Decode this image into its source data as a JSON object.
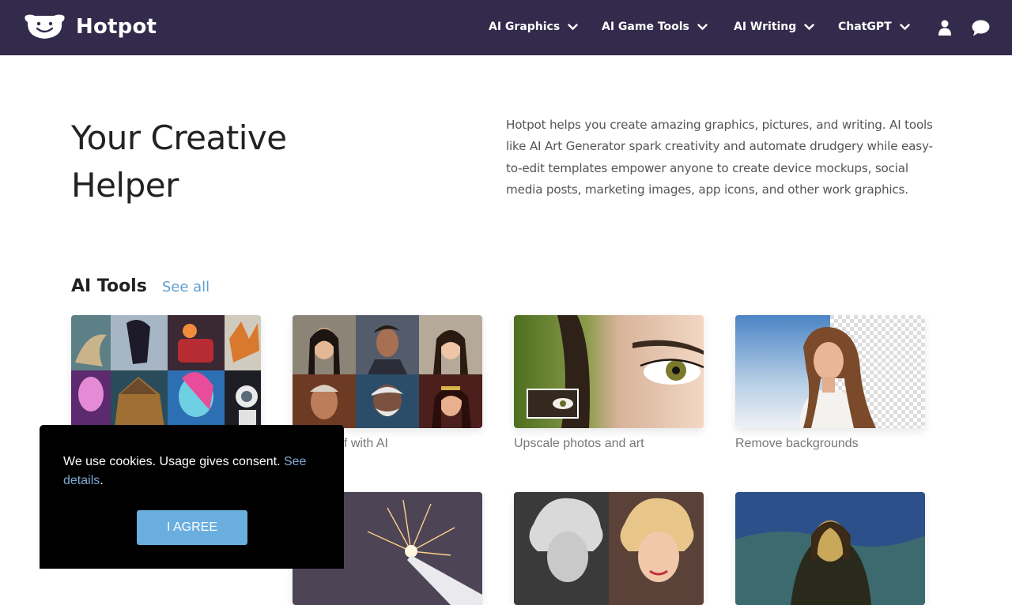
{
  "brand": {
    "name": "Hotpot"
  },
  "nav": {
    "items": [
      {
        "label": "AI Graphics"
      },
      {
        "label": "AI Game Tools"
      },
      {
        "label": "AI Writing"
      },
      {
        "label": "ChatGPT"
      }
    ],
    "icons": [
      "user-icon",
      "chat-icon",
      "chevron-down-icon"
    ]
  },
  "hero": {
    "title": "Your Creative Helper",
    "description": "Hotpot helps you create amazing graphics, pictures, and writing. AI tools like AI Art Generator spark creativity and automate drudgery while easy-to-edit templates empower anyone to create device mockups, social media posts, marketing images, app icons, and other work graphics."
  },
  "ai_tools": {
    "title": "AI Tools",
    "see_all": "See all",
    "cards": [
      {
        "label": ""
      },
      {
        "label": "e yourself with AI"
      },
      {
        "label": "Upscale photos and art"
      },
      {
        "label": "Remove backgrounds"
      },
      {
        "label": ""
      },
      {
        "label": ""
      },
      {
        "label": ""
      }
    ]
  },
  "cookie": {
    "text": "We use cookies. Usage gives consent. ",
    "link": "See details",
    "period": ".",
    "button": "I AGREE"
  },
  "colors": {
    "header_bg": "#332b4b",
    "link": "#5e9fd1",
    "button": "#6aaee0",
    "cookie_bg": "#000000"
  }
}
